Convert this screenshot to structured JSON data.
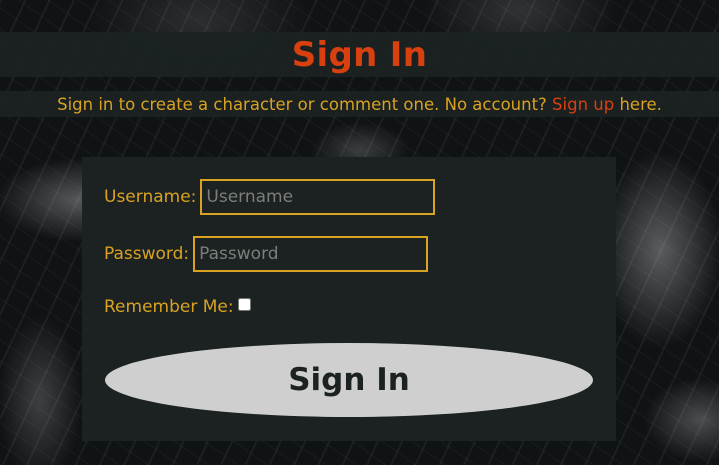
{
  "page": {
    "title": "Sign In"
  },
  "subtitle": {
    "text_before": "Sign in to create a character or comment one. No account? ",
    "link_label": "Sign up",
    "text_after": " here."
  },
  "form": {
    "username_label": "Username:",
    "username_placeholder": "Username",
    "username_value": "",
    "password_label": "Password:",
    "password_placeholder": "Password",
    "password_value": "",
    "remember_label": "Remember Me:",
    "remember_checked": false,
    "submit_label": "Sign In"
  },
  "colors": {
    "accent": "#d9400f",
    "gold": "#d9a223",
    "panel": "#1b2221",
    "button": "#cfcfcf"
  }
}
